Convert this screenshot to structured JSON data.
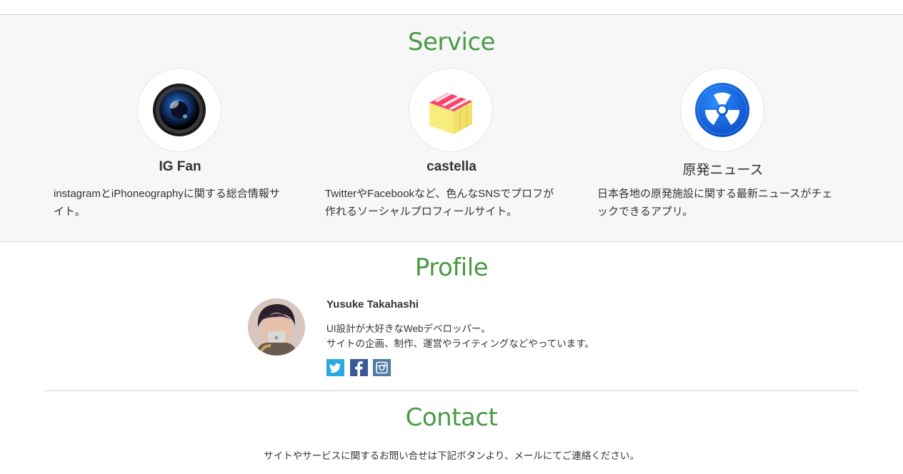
{
  "service": {
    "title": "Service",
    "items": [
      {
        "name": "IG Fan",
        "icon": "camera-lens-icon",
        "desc_lines": [
          "instagramとiPhoneographyに関する総合情報サ",
          "イト。"
        ]
      },
      {
        "name": "castella",
        "icon": "castella-box-icon",
        "desc_lines": [
          "TwitterやFacebookなど、色んなSNSでプロフが",
          "作れるソーシャルプロフィールサイト。"
        ]
      },
      {
        "name": "原発ニュース",
        "icon": "radiation-icon",
        "desc_lines": [
          "日本各地の原発施設に関する最新ニュースがチェ",
          "ックできるアプリ。"
        ]
      }
    ]
  },
  "profile": {
    "title": "Profile",
    "name": "Yusuke Takahashi",
    "bio_lines": [
      "UI設計が大好きなWebデベロッパー。",
      "サイトの企画、制作、運営やライティングなどやっています。"
    ],
    "social": [
      {
        "icon": "twitter-icon",
        "color": "#2aa9e0"
      },
      {
        "icon": "facebook-icon",
        "color": "#3b5998"
      },
      {
        "icon": "instagram-icon",
        "color": "#4e7aa6"
      }
    ]
  },
  "contact": {
    "title": "Contact",
    "text": "サイトやサービスに関するお問い合せは下記ボタンより、メールにてご連絡ください。"
  },
  "colors": {
    "accent": "#4a9a45",
    "band": "#f7f7f7"
  }
}
